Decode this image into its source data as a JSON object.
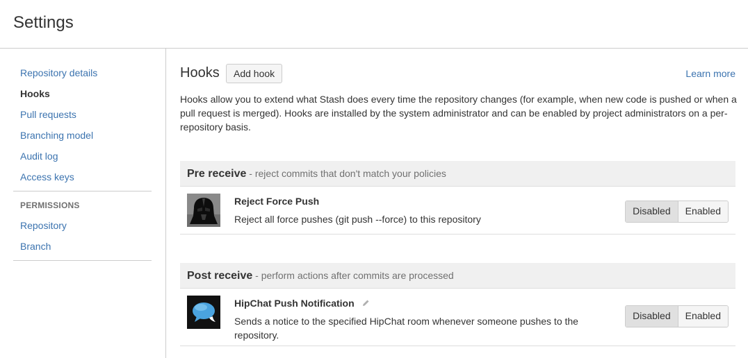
{
  "header": {
    "title": "Settings"
  },
  "sidebar": {
    "items": [
      {
        "label": "Repository details"
      },
      {
        "label": "Hooks"
      },
      {
        "label": "Pull requests"
      },
      {
        "label": "Branching model"
      },
      {
        "label": "Audit log"
      },
      {
        "label": "Access keys"
      }
    ],
    "permissions_heading": "PERMISSIONS",
    "permissions": [
      {
        "label": "Repository"
      },
      {
        "label": "Branch"
      }
    ]
  },
  "main": {
    "title": "Hooks",
    "add_hook_label": "Add hook",
    "learn_more": "Learn more",
    "description": "Hooks allow you to extend what Stash does every time the repository changes (for example, when new code is pushed or when a pull request is merged). Hooks are installed by the system administrator and can be enabled by project administrators on a per-repository basis.",
    "sections": [
      {
        "name": "Pre receive",
        "subtitle": " - reject commits that don't match your policies",
        "hooks": [
          {
            "name": "Reject Force Push",
            "description": "Reject all force pushes (git push --force) to this repository",
            "icon": "darth-vader-icon",
            "toggle": {
              "disabled": "Disabled",
              "enabled": "Enabled",
              "selected": "Disabled"
            }
          }
        ]
      },
      {
        "name": "Post receive",
        "subtitle": " - perform actions after commits are processed",
        "hooks": [
          {
            "name": "HipChat Push Notification",
            "description": "Sends a notice to the specified HipChat room whenever someone pushes to the repository.",
            "icon": "hipchat-icon",
            "toggle": {
              "disabled": "Disabled",
              "enabled": "Enabled",
              "selected": "Disabled"
            }
          }
        ]
      }
    ]
  },
  "colors": {
    "link": "#3b73af",
    "text": "#333333",
    "muted": "#707070",
    "section_bg": "#f0f0f0"
  }
}
